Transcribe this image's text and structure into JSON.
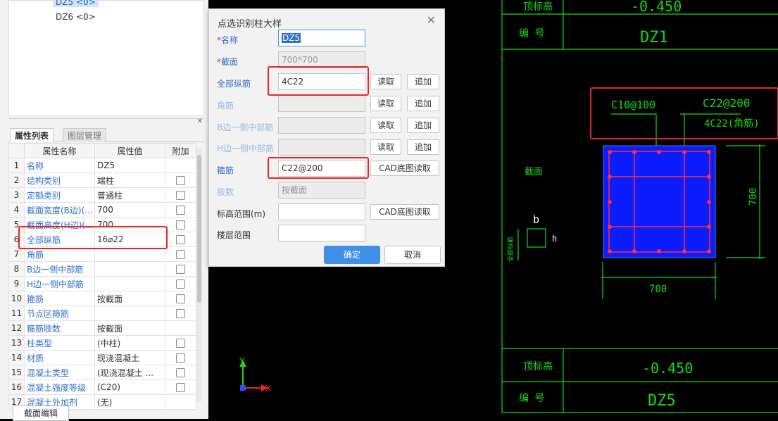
{
  "tree": {
    "items": [
      "DZ5 <0>",
      "DZ6 <0>"
    ]
  },
  "tabs": {
    "attr_list": "属性列表",
    "layer_mgmt": "图层管理"
  },
  "table": {
    "headers": [
      "属性名称",
      "属性值",
      "附加"
    ],
    "rows": [
      {
        "idx": "1",
        "name": "名称",
        "value": "DZ5",
        "check": false
      },
      {
        "idx": "2",
        "name": "结构类别",
        "value": "端柱",
        "check": true
      },
      {
        "idx": "3",
        "name": "定额类别",
        "value": "普通柱",
        "check": true
      },
      {
        "idx": "4",
        "name": "截面宽度(B边)(...",
        "value": "700",
        "check": true
      },
      {
        "idx": "5",
        "name": "截面高度(H边)(...",
        "value": "700",
        "check": true
      },
      {
        "idx": "6",
        "name": "全部纵筋",
        "value": "16⌀22",
        "check": true
      },
      {
        "idx": "7",
        "name": "角筋",
        "value": "",
        "check": true
      },
      {
        "idx": "8",
        "name": "B边一侧中部筋",
        "value": "",
        "check": true
      },
      {
        "idx": "9",
        "name": "H边一侧中部筋",
        "value": "",
        "check": true
      },
      {
        "idx": "10",
        "name": "箍筋",
        "value": "按截面",
        "check": true
      },
      {
        "idx": "11",
        "name": "节点区箍筋",
        "value": "",
        "check": true
      },
      {
        "idx": "12",
        "name": "箍筋肢数",
        "value": "按截面",
        "check": false
      },
      {
        "idx": "13",
        "name": "柱类型",
        "value": "(中柱)",
        "check": true
      },
      {
        "idx": "14",
        "name": "材质",
        "value": "现浇混凝土",
        "check": true
      },
      {
        "idx": "15",
        "name": "混凝土类型",
        "value": "(现浇混凝土 ...",
        "check": true
      },
      {
        "idx": "16",
        "name": "混凝土强度等级",
        "value": "(C20)",
        "check": true
      },
      {
        "idx": "17",
        "name": "混凝土外加剂",
        "value": "(无)",
        "check": false
      }
    ]
  },
  "bottom_button": "截面编辑",
  "dialog": {
    "title": "点选识别柱大样",
    "fields": {
      "name_label": "名称",
      "name_value": "DZ5",
      "section_label": "截面",
      "section_value": "700*700",
      "all_bars_label": "全部纵筋",
      "all_bars_value": "4C22",
      "corner_label": "角筋",
      "b_mid_label": "B边一侧中部筋",
      "h_mid_label": "H边一侧中部筋",
      "stirrup_label": "箍筋",
      "stirrup_value": "C22@200",
      "legs_label": "肢数",
      "legs_value": "按截面",
      "elev_label": "标高范围(m)",
      "floor_label": "楼层范围"
    },
    "buttons": {
      "read": "读取",
      "append": "追加",
      "cad_read": "CAD底图读取",
      "ok": "确定",
      "cancel": "取消"
    }
  },
  "cad": {
    "elev_top": "-0.450",
    "code_label": "编 号",
    "elev_label": "顶标高",
    "code_top": "DZ1",
    "section_label": "截面",
    "stirrup_note": "C10@100",
    "bars_note": "C22@200",
    "bars_note2": "4C22(角筋)",
    "dim_h": "700",
    "dim_w": "700",
    "axis_b": "b",
    "axis_h": "h",
    "side_note": "全部纵筋",
    "elev_bottom": "-0.450",
    "code_bottom": "DZ5",
    "axis_x": "X",
    "axis_y": "Y"
  }
}
